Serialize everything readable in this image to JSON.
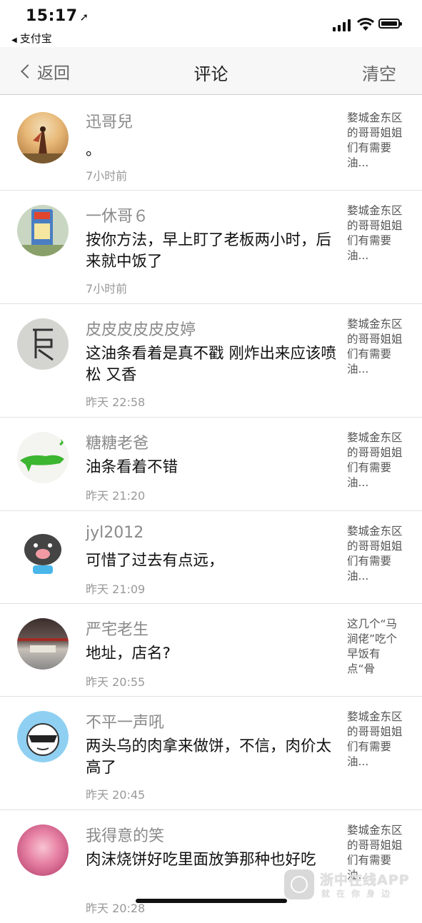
{
  "status_bar": {
    "time": "15:17",
    "location_arrow": "➚",
    "back_app": "支付宝"
  },
  "nav": {
    "back_label": "返回",
    "title": "评论",
    "clear_label": "清空"
  },
  "comments": [
    {
      "name": "迅哥兒",
      "text": "。",
      "time": "7小时前",
      "excerpt": "婺城金东区的哥哥姐姐们有需要油..."
    },
    {
      "name": "一休哥６",
      "text": "按你方法，早上盯了老板两小时，后来就中饭了",
      "time": "7小时前",
      "excerpt": "婺城金东区的哥哥姐姐们有需要油..."
    },
    {
      "name": "皮皮皮皮皮皮婷",
      "text": "这油条看着是真不戳 刚炸出来应该喷松 又香",
      "time": "昨天 22:58",
      "excerpt": "婺城金东区的哥哥姐姐们有需要油..."
    },
    {
      "name": "糖糖老爸",
      "text": "油条看着不错",
      "time": "昨天 21:20",
      "excerpt": "婺城金东区的哥哥姐姐们有需要油..."
    },
    {
      "name": "jyl2012",
      "text": "可惜了过去有点远，",
      "time": "昨天 21:09",
      "excerpt": "婺城金东区的哥哥姐姐们有需要油..."
    },
    {
      "name": "严宅老生",
      "text": "地址，店名?",
      "time": "昨天 20:55",
      "excerpt": "这几个“马涧佬”吃个早饭有点“骨躁”个"
    },
    {
      "name": "不平一声吼",
      "text": "两头乌的肉拿来做饼，不信，肉价太高了",
      "time": "昨天 20:45",
      "excerpt": "婺城金东区的哥哥姐姐们有需要油..."
    },
    {
      "name": "我得意的笑",
      "text": "肉沫烧饼好吃里面放笋那种也好吃",
      "time": "昨天 20:28",
      "excerpt": "婺城金东区的哥哥姐姐们有需要油..."
    }
  ],
  "watermark": {
    "title": "浙中在线APP",
    "subtitle": "就在你身边"
  },
  "icons": [
    "location-arrow-icon",
    "back-triangle-icon",
    "signal-icon",
    "wifi-icon",
    "battery-icon",
    "chevron-left-icon"
  ]
}
